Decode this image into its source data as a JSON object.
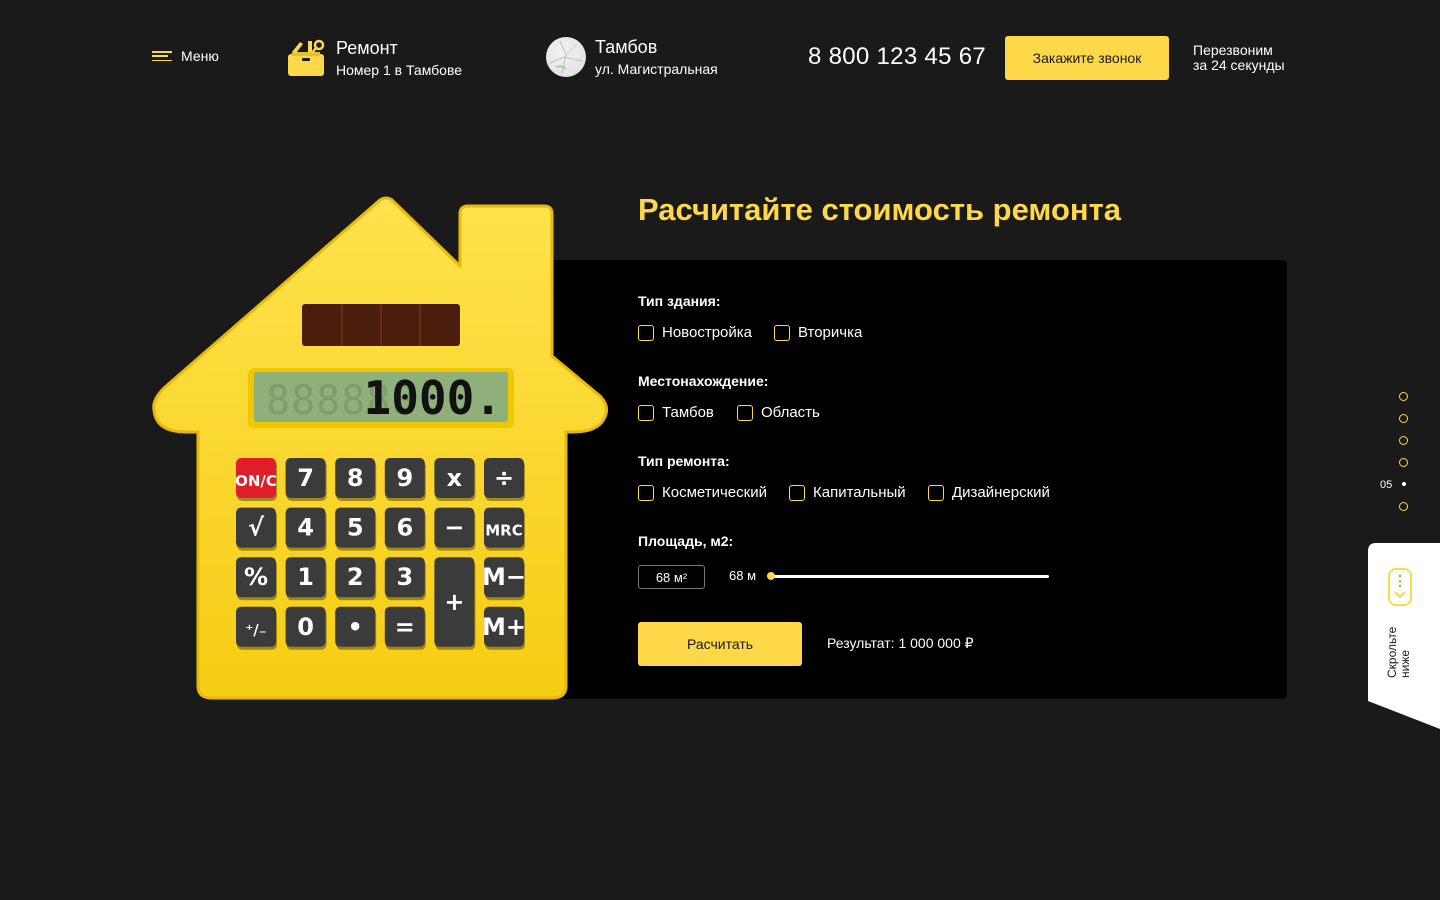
{
  "header": {
    "menu_label": "Меню",
    "brand_title": "Ремонт",
    "brand_subtitle": "Номер 1 в Тамбове",
    "city": "Тамбов",
    "street": "ул. Магистральная",
    "phone": "8 800 123 45 67",
    "call_button": "Закажите звонок",
    "callback_line1": "Перезвоним",
    "callback_line2": "за 24 секунды"
  },
  "main": {
    "title": "Расчитайте стоимость ремонта"
  },
  "form": {
    "building": {
      "label": "Тип здания:",
      "options": [
        "Новостройка",
        "Вторичка"
      ]
    },
    "location": {
      "label": "Местонахождение:",
      "options": [
        "Тамбов",
        "Область"
      ]
    },
    "repair": {
      "label": "Тип ремонта:",
      "options": [
        "Косметический",
        "Капитальный",
        "Дизайнерский"
      ]
    },
    "area": {
      "label": "Площадь, м2:",
      "input_value": "68 м²",
      "slider_value_text": "68 м",
      "slider_fraction": 0.0
    },
    "submit_label": "Расчитать",
    "result_text": "Результат: 1 000 000 ₽"
  },
  "calculator": {
    "display": "1000.",
    "keys": [
      "ON/C",
      "7",
      "8",
      "9",
      "x",
      "÷",
      "√",
      "4",
      "5",
      "6",
      "−",
      "MRC",
      "%",
      "1",
      "2",
      "3",
      "+",
      "M−",
      "⁺∕₋",
      "0",
      "•",
      "=",
      "M+"
    ]
  },
  "sidenav": {
    "current_page": "05"
  },
  "scroll_hint": {
    "line1": "Скрольте",
    "line2": "ниже"
  },
  "colors": {
    "accent": "#ffd84a",
    "background": "#1a1a1a",
    "panel": "#000000"
  }
}
